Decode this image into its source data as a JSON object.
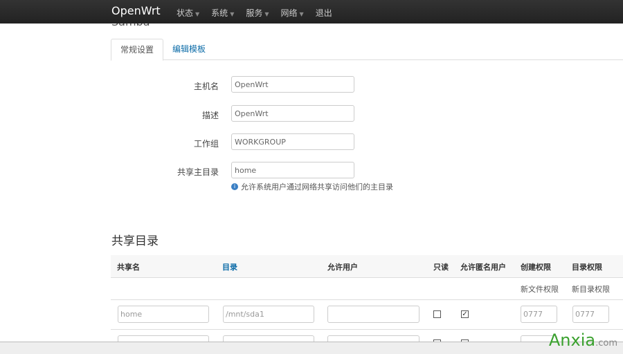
{
  "nav": {
    "brand": "OpenWrt",
    "menu": [
      {
        "label": "状态"
      },
      {
        "label": "系统"
      },
      {
        "label": "服务"
      },
      {
        "label": "网络"
      },
      {
        "label": "退出"
      }
    ]
  },
  "section_title": "Samba",
  "tabs": [
    {
      "label": "常规设置",
      "active": true
    },
    {
      "label": "编辑模板",
      "active": false
    }
  ],
  "form": [
    {
      "label": "主机名",
      "value": "OpenWrt"
    },
    {
      "label": "描述",
      "value": "OpenWrt"
    },
    {
      "label": "工作组",
      "value": "WORKGROUP"
    },
    {
      "label": "共享主目录",
      "value": "home"
    }
  ],
  "hint": "允许系统用户通过网络共享访问他们的主目录",
  "shares": {
    "title": "共享目录",
    "headers": [
      "共享名",
      "目录",
      "允许用户",
      "只读",
      "允许匿名用户",
      "创建权限",
      "目录权限"
    ],
    "subheaders": {
      "create": "新文件权限",
      "dir": "新目录权限"
    },
    "rows": [
      {
        "name": "home",
        "path": "/mnt/sda1",
        "users": "",
        "readonly": false,
        "guest": true,
        "create_mask": "0777",
        "dir_mask": "0777"
      }
    ]
  },
  "watermark": {
    "text": "Anxia",
    "suffix": ".com"
  }
}
